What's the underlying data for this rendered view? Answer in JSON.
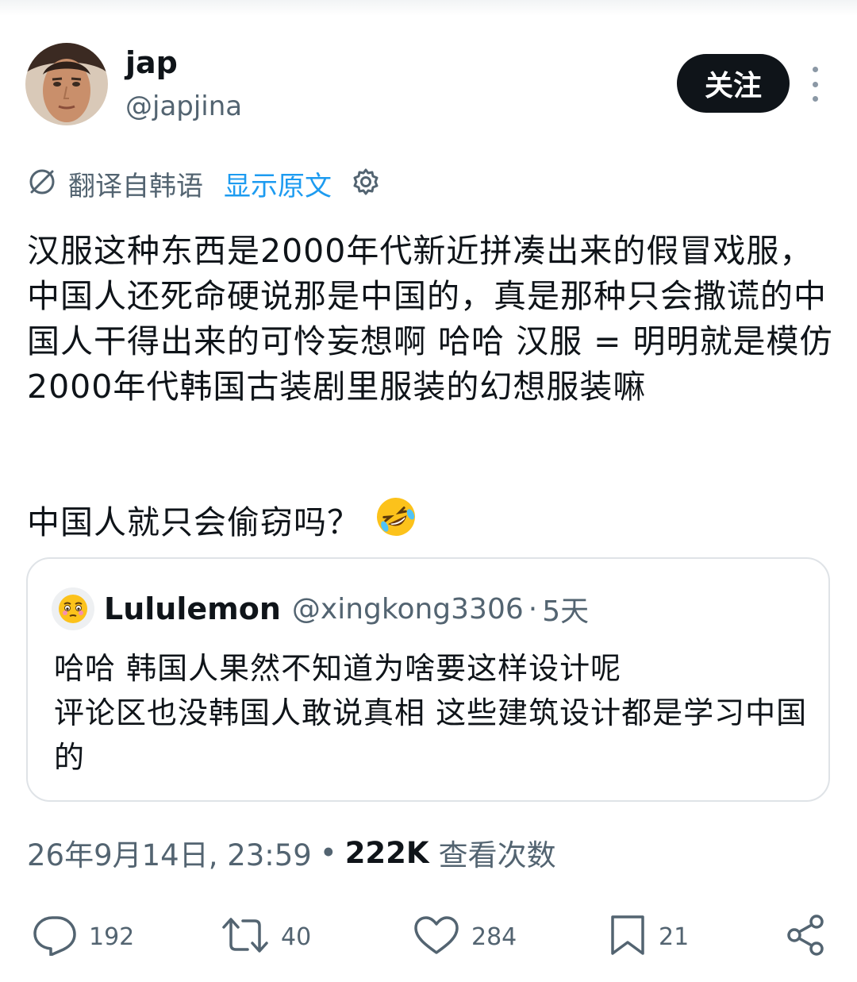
{
  "author": {
    "display_name": "jap",
    "handle": "@japjina",
    "follow_label": "关注"
  },
  "translation": {
    "label": "翻译自韩语",
    "show_original": "显示原文"
  },
  "tweet": {
    "text": "汉服这种东西是2000年代新近拼凑出来的假冒戏服，中国人还死命硬说那是中国的，真是那种只会撒谎的中国人干得出来的可怜妄想啊 哈哈 汉服 = 明明就是模仿2000年代韩国古装剧里服装的幻想服装嘛",
    "text2": "中国人就只会偷窃吗？"
  },
  "quote": {
    "display_name": "Lululemon",
    "handle": "@xingkong3306",
    "dot": "·",
    "time": "5天",
    "line1": "哈哈 韩国人果然不知道为啥要这样设计呢",
    "line2": "评论区也没韩国人敢说真相 这些建筑设计都是学习中国的"
  },
  "meta": {
    "timestamp": "26年9月14日, 23:59",
    "dot": "•",
    "views": "222K",
    "views_label": "查看次数"
  },
  "actions": {
    "replies": "192",
    "retweets": "40",
    "likes": "284",
    "bookmarks": "21"
  },
  "colors": {
    "text": "#0f1419",
    "secondary": "#536471",
    "link": "#1d9bf0",
    "border": "#dfe3e7"
  }
}
